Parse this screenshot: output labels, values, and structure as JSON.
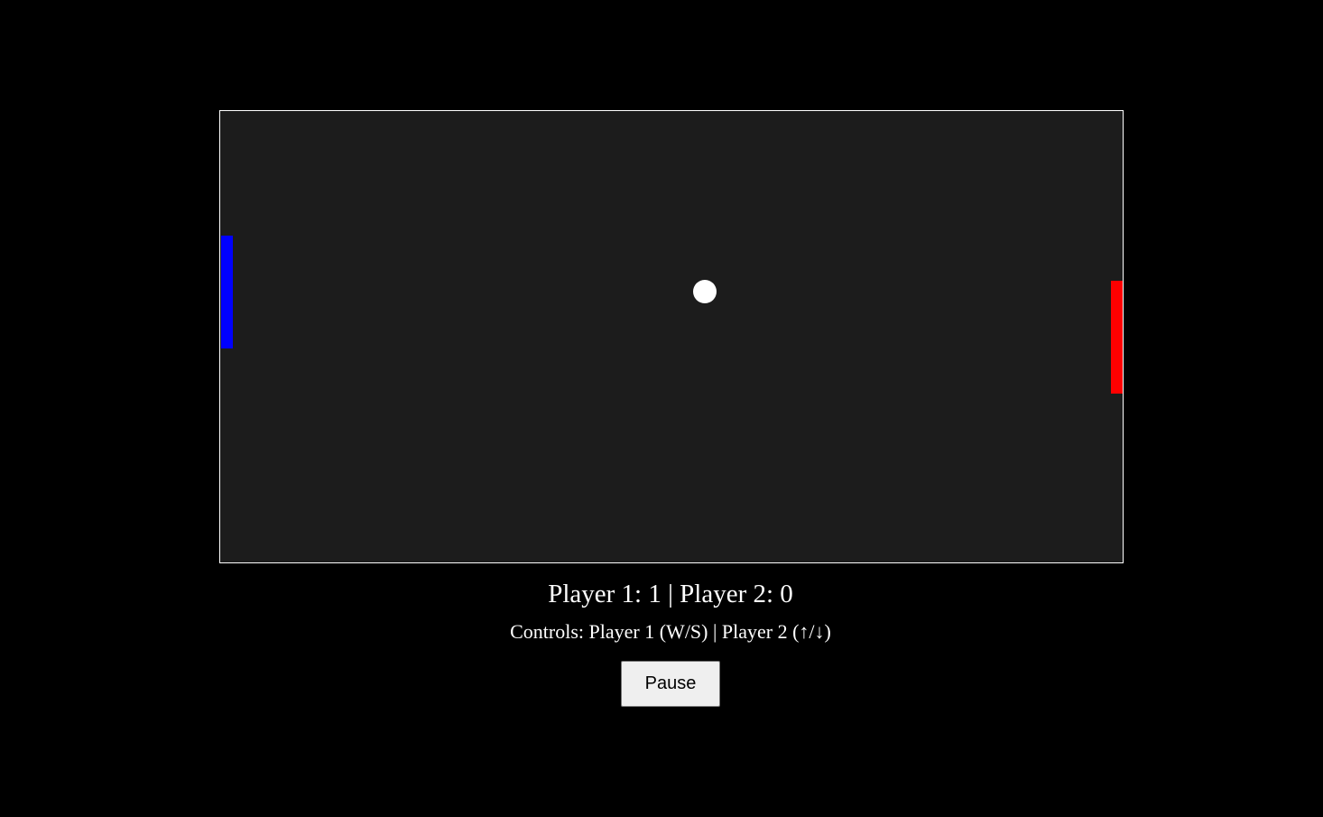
{
  "game": {
    "colors": {
      "background": "#000000",
      "board": "#1c1c1c",
      "board_border": "#ffffff",
      "player1_paddle": "#0000ff",
      "player2_paddle": "#ff0000",
      "ball": "#ffffff"
    },
    "score_text": "Player 1: 1 | Player 2: 0",
    "controls_text": "Controls: Player 1 (W/S) | Player 2 (↑/↓)",
    "pause_label": "Pause"
  }
}
